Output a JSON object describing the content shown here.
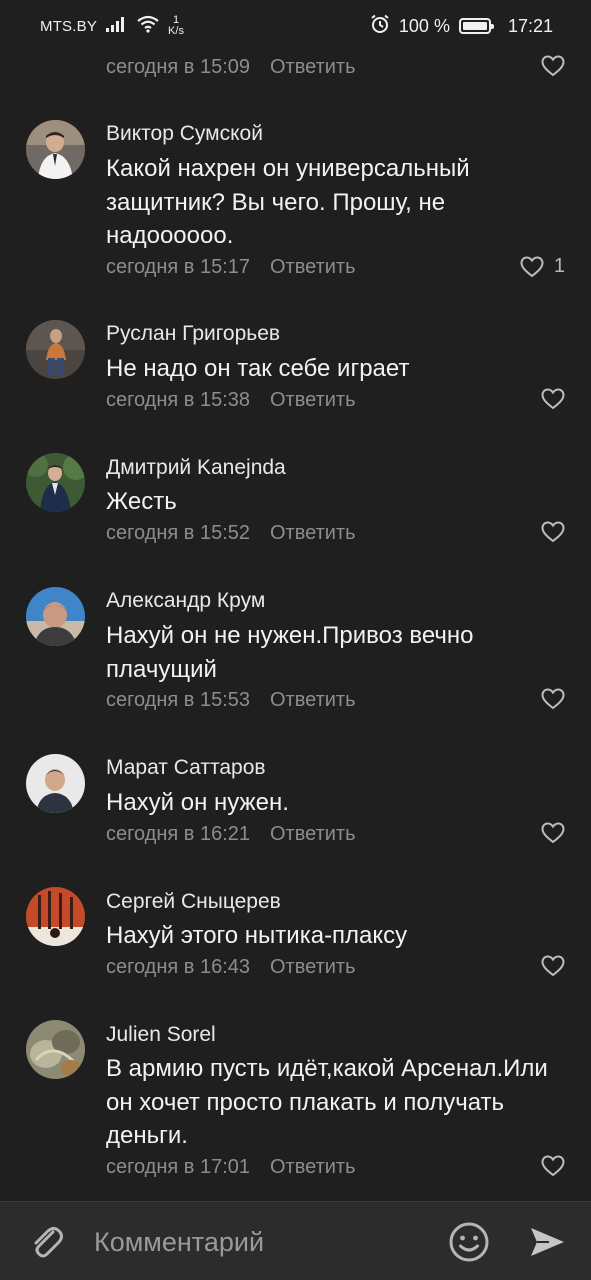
{
  "status_bar": {
    "carrier": "MTS.BY",
    "speed_value": "1",
    "speed_unit": "K/s",
    "battery_percent": "100 %",
    "time": "17:21"
  },
  "comments": [
    {
      "author": "",
      "text": "",
      "time": "сегодня в 15:09",
      "reply_label": "Ответить",
      "likes": ""
    },
    {
      "author": "Виктор Сумской",
      "text": "Какой нахрен он универсальный защитник? Вы чего. Прошу, не надоооооо.",
      "time": "сегодня в 15:17",
      "reply_label": "Ответить",
      "likes": "1"
    },
    {
      "author": "Руслан Григорьев",
      "text": "Не надо он так себе играет",
      "time": "сегодня в 15:38",
      "reply_label": "Ответить",
      "likes": ""
    },
    {
      "author": "Дмитрий Kanejnda",
      "text": "Жесть",
      "time": "сегодня в 15:52",
      "reply_label": "Ответить",
      "likes": ""
    },
    {
      "author": "Александр Крум",
      "text": "Нахуй он не нужен.Привоз вечно плачущий",
      "time": "сегодня в 15:53",
      "reply_label": "Ответить",
      "likes": ""
    },
    {
      "author": "Марат Саттаров",
      "text": "Нахуй он нужен.",
      "time": "сегодня в 16:21",
      "reply_label": "Ответить",
      "likes": ""
    },
    {
      "author": "Сергей Сныцерев",
      "text": "Нахуй этого нытика-плаксу",
      "time": "сегодня в 16:43",
      "reply_label": "Ответить",
      "likes": ""
    },
    {
      "author": "Julien Sorel",
      "text": "В армию пусть идёт,какой Арсенал.Или он хочет просто плакать и получать деньги.",
      "time": "сегодня в 17:01",
      "reply_label": "Ответить",
      "likes": ""
    }
  ],
  "input_bar": {
    "placeholder": "Комментарий",
    "attach_icon": "paperclip-icon",
    "emoji_icon": "smiley-icon",
    "send_icon": "send-arrow-icon"
  },
  "colors": {
    "background": "#1f1f1f",
    "input_bar": "#2c2c2c",
    "meta_text": "#8d8d8d"
  }
}
